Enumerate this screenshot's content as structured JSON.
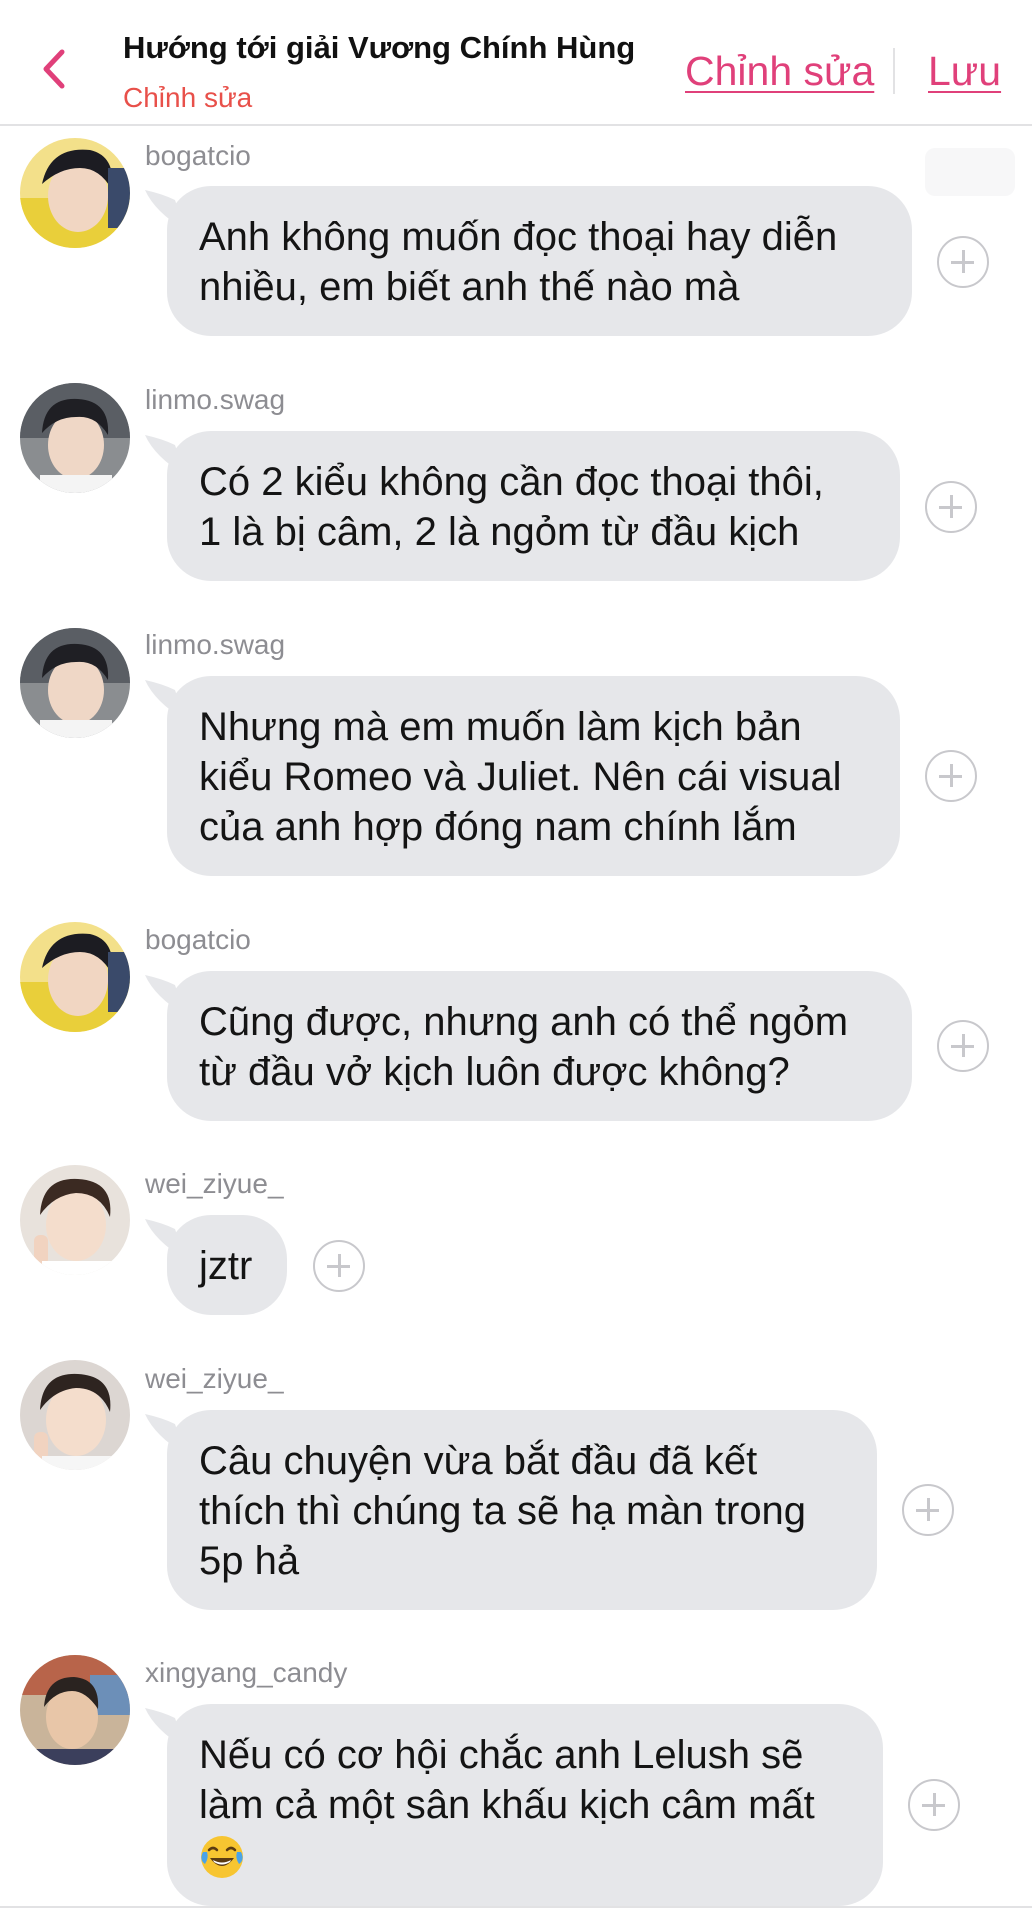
{
  "header": {
    "title": "Hướng tới giải Vương Chính Hùng",
    "subtitle": "Chỉnh sửa",
    "edit_label": "Chỉnh sửa",
    "save_label": "Lưu",
    "back_icon": "chevron-left-icon",
    "accent_color": "#e0407a"
  },
  "messages": [
    {
      "username": "bogatcio",
      "text": "Anh không muốn đọc thoại hay diễn\nnhiều, em biết anh thế nào mà"
    },
    {
      "username": "linmo.swag",
      "text": "Có 2 kiểu không cần đọc thoại thôi,\n1 là bị câm, 2 là ngỏm từ đầu kịch"
    },
    {
      "username": "linmo.swag",
      "text": "Nhưng mà em muốn làm kịch bản\nkiểu Romeo và Juliet. Nên cái visual\ncủa anh hợp đóng nam chính lắm"
    },
    {
      "username": "bogatcio",
      "text": "Cũng được, nhưng anh có thể ngỏm\ntừ đầu vở kịch luôn được không?"
    },
    {
      "username": "wei_ziyue_",
      "text": "jztr"
    },
    {
      "username": "wei_ziyue_",
      "text": "Câu chuyện vừa bắt đầu đã kết\nthích thì chúng ta sẽ hạ màn trong\n5p hả"
    },
    {
      "username": "xingyang_candy",
      "text": "Nếu có cơ hội chắc anh Lelush sẽ\nlàm cả một sân khấu kịch câm mất",
      "emoji": "face-with-tears-of-joy-icon"
    }
  ],
  "bubble_color": "#e6e7ea",
  "add_icon": "plus-circle-icon"
}
